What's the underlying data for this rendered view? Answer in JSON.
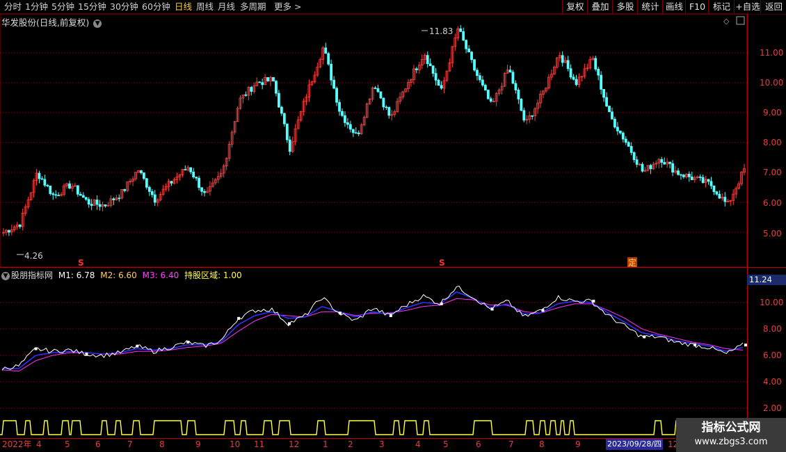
{
  "toolbar": {
    "periods": [
      "分时",
      "1分钟",
      "5分钟",
      "15分钟",
      "30分钟",
      "60分钟",
      "日线",
      "周线",
      "月线",
      "多周期",
      "更多 >"
    ],
    "active_period": "日线",
    "buttons": [
      "复权",
      "叠加",
      "多股",
      "统计",
      "画线",
      "F10",
      "标记",
      "+自选",
      "返回"
    ]
  },
  "stock": {
    "title": "华发股份(日线,前复权)",
    "high_label": "11.83",
    "low_label": "4.26",
    "price_ticks": [
      "11.00",
      "10.00",
      "9.00",
      "8.00",
      "7.00",
      "6.00",
      "5.00"
    ],
    "markers": [
      "S",
      "S",
      "定"
    ]
  },
  "indicator": {
    "name": "股朋指标网",
    "m1_label": "M1: 6.78",
    "m2_label": "M2: 6.60",
    "m3_label": "M3: 6.40",
    "zone_label": "持股区域: 1.00",
    "ticks": [
      "10.00",
      "8.00",
      "6.00",
      "4.00",
      "2.00"
    ],
    "current_value": "11.24"
  },
  "time_axis": {
    "labels": [
      "2022年",
      "4",
      "5",
      "6",
      "7",
      "8",
      "9",
      "10",
      "11",
      "12",
      "1",
      "2",
      "3",
      "4",
      "5",
      "6",
      "7",
      "8",
      "9",
      "12"
    ],
    "selected_date": "2023/09/28/四"
  },
  "watermark": {
    "name": "指标公式网",
    "url": "www.zbgs3.com"
  },
  "colors": {
    "up": "#ff4040",
    "down": "#54ffff",
    "m1": "#ffffff",
    "m2": "#3030ff",
    "m3": "#ff30ff",
    "zone": "#ffff44",
    "grid": "#8a0000"
  },
  "chart_data": {
    "type": "candlestick",
    "series": [
      {
        "name": "close",
        "values": [
          5.0,
          5.3,
          7.0,
          6.2,
          6.6,
          6.0,
          5.9,
          6.3,
          7.1,
          6.1,
          6.7,
          7.2,
          6.2,
          7.0,
          9.4,
          10.0,
          10.1,
          7.8,
          9.6,
          11.2,
          9.0,
          8.2,
          10.0,
          8.8,
          10.0,
          11.0,
          9.7,
          11.83,
          10.4,
          9.2,
          10.5,
          8.6,
          9.6,
          11.0,
          10.0,
          10.8,
          8.9,
          8.0,
          7.0,
          7.5,
          7.0,
          6.8,
          6.6,
          5.9,
          7.1
        ]
      },
      {
        "name": "M1",
        "values": [
          5.0,
          5.2,
          6.5,
          6.3,
          6.4,
          6.1,
          6.0,
          6.2,
          6.7,
          6.3,
          6.6,
          7.0,
          6.7,
          7.1,
          8.8,
          9.4,
          9.5,
          8.4,
          9.0,
          10.4,
          9.2,
          8.6,
          9.6,
          9.0,
          9.8,
          10.5,
          9.9,
          11.2,
          10.4,
          9.5,
          10.1,
          8.9,
          9.4,
          10.4,
          10.1,
          10.1,
          9.0,
          8.2,
          7.4,
          7.4,
          7.0,
          6.8,
          6.6,
          6.1,
          6.78
        ]
      },
      {
        "name": "M2",
        "values": [
          5.0,
          5.0,
          6.0,
          6.2,
          6.3,
          6.2,
          6.1,
          6.2,
          6.5,
          6.4,
          6.5,
          6.8,
          6.8,
          7.0,
          8.3,
          9.0,
          9.3,
          8.8,
          8.9,
          9.7,
          9.3,
          8.9,
          9.3,
          9.1,
          9.6,
          10.0,
          9.9,
          10.8,
          10.3,
          9.6,
          9.9,
          9.1,
          9.2,
          9.9,
          10.1,
          10.0,
          9.2,
          8.5,
          7.7,
          7.5,
          7.1,
          6.9,
          6.7,
          6.3,
          6.6
        ]
      },
      {
        "name": "M3",
        "values": [
          4.9,
          4.8,
          5.6,
          6.0,
          6.2,
          6.2,
          6.1,
          6.1,
          6.3,
          6.3,
          6.4,
          6.6,
          6.7,
          6.9,
          7.8,
          8.6,
          9.1,
          9.0,
          8.9,
          9.3,
          9.3,
          9.0,
          9.2,
          9.2,
          9.4,
          9.7,
          9.8,
          10.3,
          10.2,
          9.8,
          9.8,
          9.3,
          9.2,
          9.6,
          9.9,
          9.9,
          9.4,
          8.8,
          8.0,
          7.6,
          7.3,
          7.0,
          6.8,
          6.5,
          6.4
        ]
      }
    ],
    "price_axis": [
      4.5,
      11.9
    ],
    "indicator_axis": [
      1.5,
      11.5
    ]
  }
}
